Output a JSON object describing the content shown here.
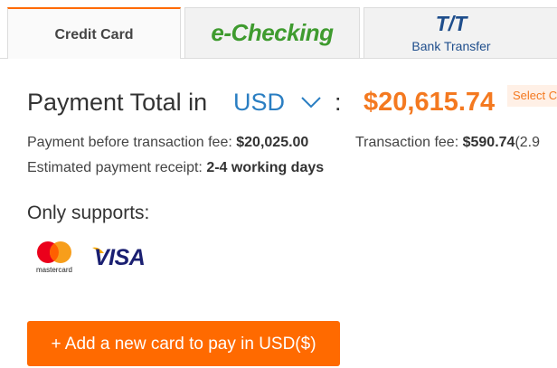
{
  "tabs": {
    "credit_card": "Credit Card",
    "echecking": "e-Checking",
    "tt_logo": "T/T",
    "tt_subtitle": "Bank Transfer"
  },
  "payment": {
    "total_label": "Payment Total in",
    "currency": "USD",
    "colon": ":",
    "total_amount": "$20,615.74",
    "select_badge": "Select C",
    "before_fee_label": "Payment before transaction fee:",
    "before_fee_value": "$20,025.00",
    "fee_label": "Transaction fee:",
    "fee_value": "$590.74",
    "fee_rate_partial": "(2.9",
    "receipt_label": "Estimated payment receipt:",
    "receipt_value": "2-4 working days"
  },
  "supports": {
    "label": "Only supports:",
    "cards": [
      "mastercard",
      "VISA"
    ]
  },
  "add_button": "+ Add a new card to pay in USD($)",
  "colors": {
    "accent": "#ff6a00",
    "amount": "#f47920",
    "currency": "#2a7ec2",
    "echecking": "#3f9b2f",
    "tt": "#1f4e8c"
  }
}
